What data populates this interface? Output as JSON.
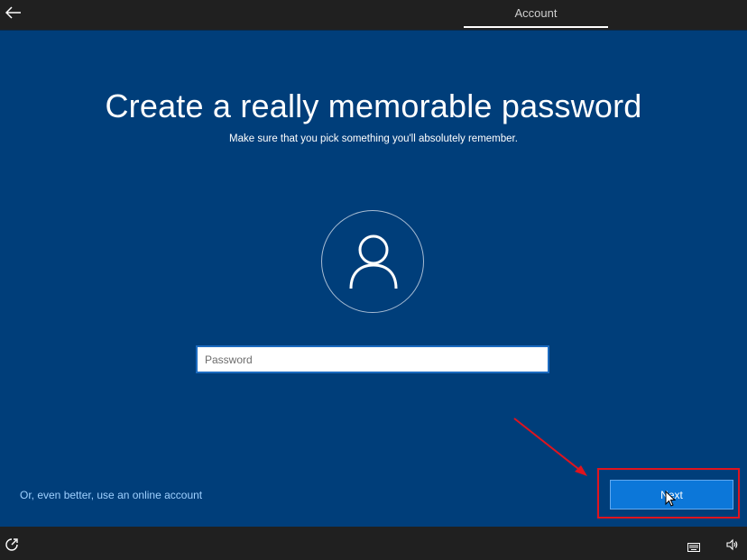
{
  "header": {
    "tab_account": "Account"
  },
  "page": {
    "title": "Create a really memorable password",
    "subtitle": "Make sure that you pick something you'll absolutely remember."
  },
  "password": {
    "placeholder": "Password",
    "value": ""
  },
  "footer": {
    "online_account_link": "Or, even better, use an online account",
    "next_label": "Next"
  },
  "icons": {
    "back": "arrow-left-icon",
    "avatar": "user-icon",
    "ease_of_access": "ease-of-access-icon",
    "keyboard": "keyboard-icon",
    "volume": "volume-icon"
  },
  "colors": {
    "background": "#003e7a",
    "topbar": "#202020",
    "accent_button": "#0c77d9",
    "link": "#9fd0ff",
    "annotation": "#e0141e"
  }
}
